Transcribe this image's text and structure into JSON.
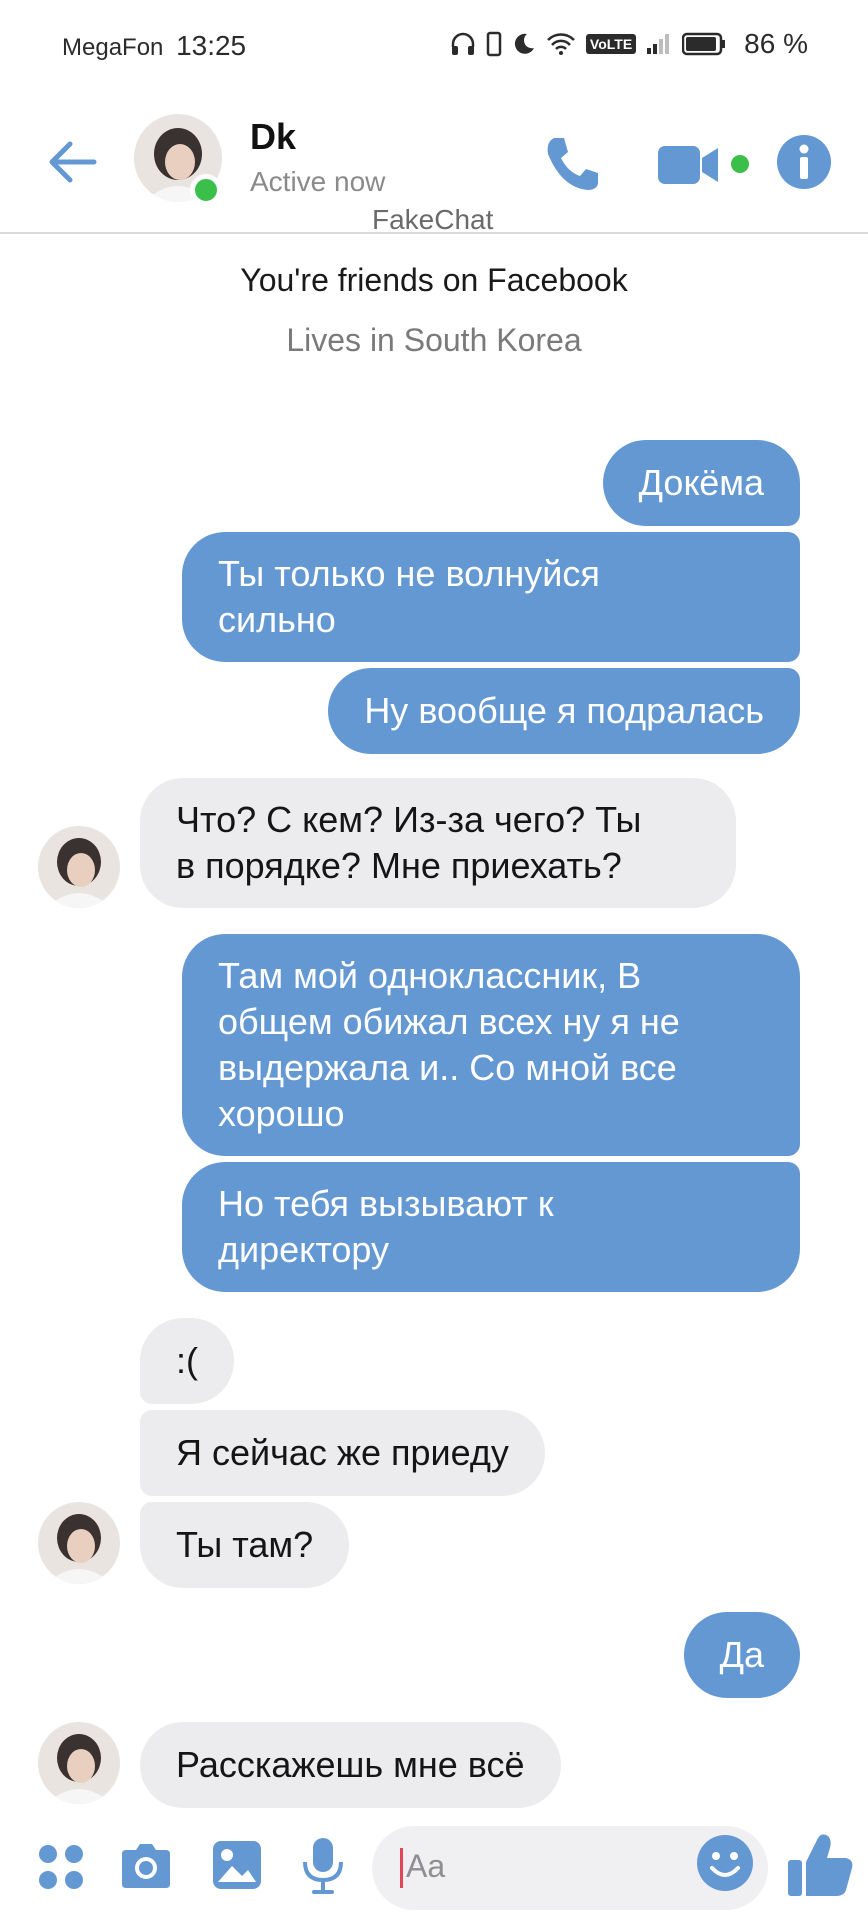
{
  "status_bar": {
    "carrier": "MegaFon",
    "time": "13:25",
    "network_badge": "VoLTE",
    "battery_percent": "86 %"
  },
  "header": {
    "name": "Dk",
    "status": "Active now",
    "watermark": "FakeChat"
  },
  "intro": {
    "friends": "You're friends on Facebook",
    "location": "Lives in South Korea"
  },
  "messages": [
    {
      "dir": "out",
      "text": "Докёма"
    },
    {
      "dir": "out",
      "lines": [
        "Ты только не волнуйся",
        "сильно"
      ]
    },
    {
      "dir": "out",
      "text": "Ну вообще я подралась"
    },
    {
      "dir": "in",
      "lines": [
        "Что? С кем? Из-за чего? Ты",
        "в порядке? Мне приехать?"
      ]
    },
    {
      "dir": "out",
      "lines": [
        "Там мой одноклассник, В",
        "общем обижал всех ну я не",
        "выдержала и.. Со мной все",
        "хорошо"
      ]
    },
    {
      "dir": "out",
      "lines": [
        "Но тебя вызывают к",
        "директору"
      ]
    },
    {
      "dir": "in",
      "text": ":("
    },
    {
      "dir": "in",
      "text": "Я сейчас же приеду"
    },
    {
      "dir": "in",
      "text": "Ты там?"
    },
    {
      "dir": "out",
      "text": "Да"
    },
    {
      "dir": "in",
      "text": "Расскажешь мне всё"
    }
  ],
  "composer": {
    "placeholder": "Aa"
  },
  "colors": {
    "accent": "#6498d3",
    "outgoing_bubble": "#6498d3",
    "incoming_bubble": "#ececee",
    "online": "#3bbf4b"
  },
  "icons": {
    "back": "back-arrow-icon",
    "call": "phone-icon",
    "video": "video-camera-icon",
    "info": "info-icon",
    "menu": "grid-dots-icon",
    "camera": "camera-icon",
    "gallery": "image-icon",
    "mic": "microphone-icon",
    "emoji": "smiley-icon",
    "like": "thumbs-up-icon"
  }
}
